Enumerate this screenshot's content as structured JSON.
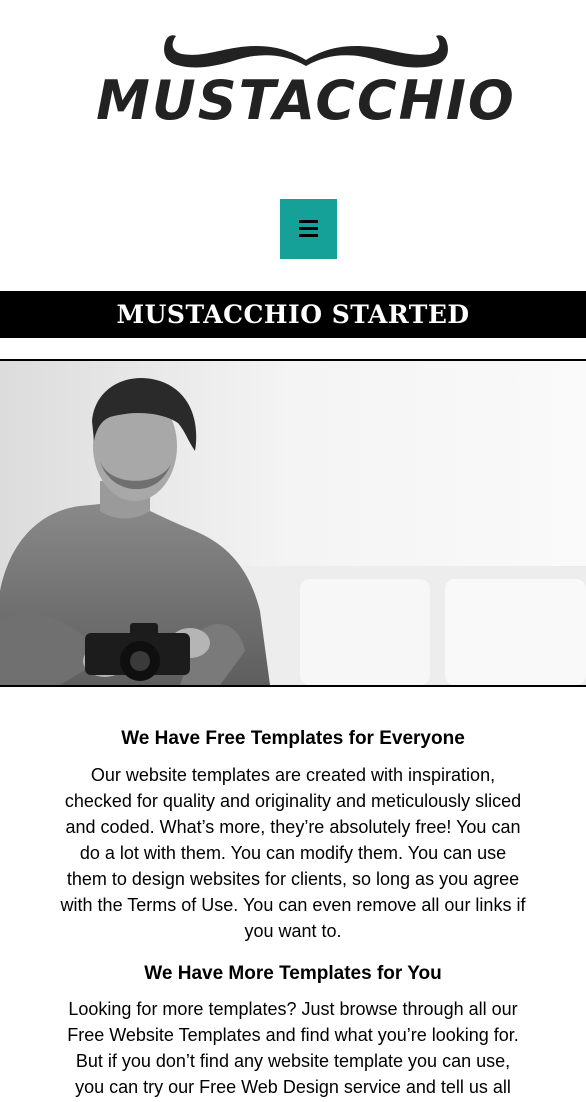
{
  "header": {
    "logo_text": "MUSTACCHIO",
    "menu_icon": "hamburger-menu-icon"
  },
  "banner": {
    "title": "MUSTACCHIO STARTED"
  },
  "hero": {
    "image": "man-with-camera-photo"
  },
  "sections": [
    {
      "heading": "We Have Free Templates for Everyone",
      "body": "Our website templates are created with inspiration, checked for quality and originality and meticulously sliced and coded. What’s more, they’re absolutely free! You can do a lot with them. You can modify them. You can use them to design websites for clients, so long as you agree with the Terms of Use. You can even remove all our links if you want to."
    },
    {
      "heading": "We Have More Templates for You",
      "body": "Looking for more templates? Just browse through all our Free Website Templates and find what you’re looking for. But if you don’t find any website template you can use, you can try our Free Web Design service and tell us all about it. Maybe you’re"
    }
  ],
  "colors": {
    "menu_button": "#15a197",
    "banner_background": "#000000",
    "banner_text": "#ffffff",
    "text": "#000000"
  }
}
